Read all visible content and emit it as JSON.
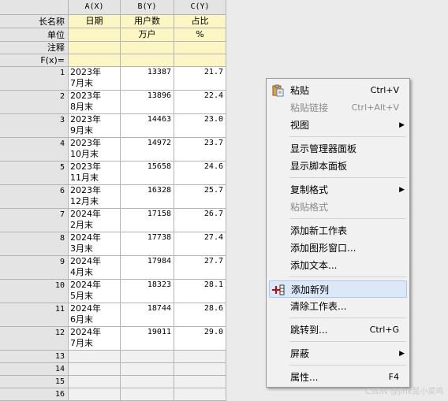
{
  "sheet": {
    "corner": "",
    "columns": [
      {
        "label": "A(X)"
      },
      {
        "label": "B(Y)"
      },
      {
        "label": "C(Y)"
      }
    ],
    "meta_rows": [
      {
        "label": "长名称",
        "values": [
          "日期",
          "用户数",
          "占比"
        ]
      },
      {
        "label": "单位",
        "values": [
          "",
          "万户",
          "%"
        ]
      },
      {
        "label": "注释",
        "values": [
          "",
          "",
          ""
        ]
      },
      {
        "label": "F(x)=",
        "values": [
          "",
          "",
          ""
        ]
      }
    ],
    "rows": [
      {
        "n": "1",
        "date1": "2023年",
        "date2": "7月末",
        "users": "13387",
        "ratio": "21.7"
      },
      {
        "n": "2",
        "date1": "2023年",
        "date2": "8月末",
        "users": "13896",
        "ratio": "22.4"
      },
      {
        "n": "3",
        "date1": "2023年",
        "date2": "9月末",
        "users": "14463",
        "ratio": "23.0"
      },
      {
        "n": "4",
        "date1": "2023年",
        "date2": "10月末",
        "users": "14972",
        "ratio": "23.7"
      },
      {
        "n": "5",
        "date1": "2023年",
        "date2": "11月末",
        "users": "15658",
        "ratio": "24.6"
      },
      {
        "n": "6",
        "date1": "2023年",
        "date2": "12月末",
        "users": "16328",
        "ratio": "25.7"
      },
      {
        "n": "7",
        "date1": "2024年",
        "date2": "2月末",
        "users": "17158",
        "ratio": "26.7"
      },
      {
        "n": "8",
        "date1": "2024年",
        "date2": "3月末",
        "users": "17738",
        "ratio": "27.4"
      },
      {
        "n": "9",
        "date1": "2024年",
        "date2": "4月末",
        "users": "17984",
        "ratio": "27.7"
      },
      {
        "n": "10",
        "date1": "2024年",
        "date2": "5月末",
        "users": "18323",
        "ratio": "28.1"
      },
      {
        "n": "11",
        "date1": "2024年",
        "date2": "6月末",
        "users": "18744",
        "ratio": "28.6"
      },
      {
        "n": "12",
        "date1": "2024年",
        "date2": "7月末",
        "users": "19011",
        "ratio": "29.0"
      }
    ],
    "empty_rows": [
      "13",
      "14",
      "15",
      "16"
    ]
  },
  "menu": {
    "paste": {
      "label": "粘贴",
      "shortcut": "Ctrl+V",
      "icon": "clipboard-icon"
    },
    "paste_link": {
      "label": "粘贴链接",
      "shortcut": "Ctrl+Alt+V"
    },
    "view": {
      "label": "视图"
    },
    "show_manager": {
      "label": "显示管理器面板"
    },
    "show_script": {
      "label": "显示脚本面板"
    },
    "copy_format": {
      "label": "复制格式"
    },
    "paste_format": {
      "label": "粘贴格式"
    },
    "add_worksheet": {
      "label": "添加新工作表"
    },
    "add_graph": {
      "label": "添加图形窗口..."
    },
    "add_text": {
      "label": "添加文本..."
    },
    "add_column": {
      "label": "添加新列",
      "icon": "add-column-icon"
    },
    "clear_worksheet": {
      "label": "清除工作表..."
    },
    "goto": {
      "label": "跳转到...",
      "shortcut": "Ctrl+G"
    },
    "mask": {
      "label": "屏蔽"
    },
    "properties": {
      "label": "属性...",
      "shortcut": "F4"
    }
  },
  "watermark": "CSDN @Jink是小菜鸡",
  "colors": {
    "meta_bg": "#fcf6c4",
    "header_bg": "#e4e4e4",
    "highlight": "#dce8f6",
    "add_icon_red": "#d40000"
  }
}
